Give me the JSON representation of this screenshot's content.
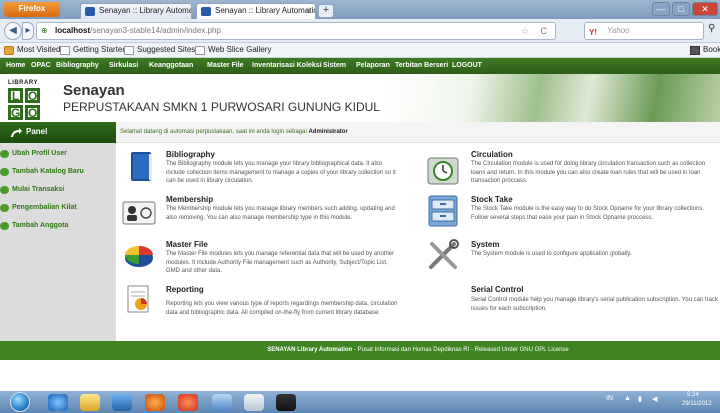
{
  "browser": {
    "menu_button": "Firefox",
    "tabs": [
      {
        "title": "Senayan :: Library Automation System"
      },
      {
        "title": "Senayan :: Library Automation System"
      }
    ],
    "new_tab": "+",
    "url_host": "localhost",
    "url_path": "/senayan3-stable14/admin/index.php",
    "search_placeholder": "Yahoo",
    "search_engine_icon": "Y!",
    "bookmarks": [
      "Most Visited",
      "Getting Started",
      "Suggested Sites",
      "Web Slice Gallery"
    ],
    "bookmarks_menu": "Bookm",
    "window_controls": [
      "—",
      "□",
      "✕"
    ]
  },
  "app_menu": [
    "Home",
    "OPAC",
    "Bibliography",
    "Sirkulasi",
    "Keanggotaan",
    "Master File",
    "Inventarisasi Koleksi",
    "Sistem",
    "Pelaporan",
    "Terbitan Berseri",
    "LOGOUT"
  ],
  "header": {
    "logo_top": "LIBRARY",
    "logo_letters": [
      "L",
      "O",
      "G",
      "O"
    ],
    "app_name": "Senayan",
    "subtitle": "PERPUSTAKAAN SMKN 1 PURWOSARI GUNUNG KIDUL"
  },
  "panel": {
    "title": "Panel",
    "items": [
      "Ubah Profil User",
      "Tambah Katalog Baru",
      "Mulai Transaksi",
      "Pengembalian Kilat",
      "Tambah Anggota"
    ]
  },
  "welcome": {
    "text": "Selamat datang di automasi perpustakaan, saat ini anda login sebagai ",
    "role": "Administrator"
  },
  "modules": [
    {
      "title": "Bibliography",
      "icon": "book-icon",
      "desc": "The Bibliography module lets you manage your library bibliographical data. It also include collection items management to manage a copies of your library collection so it can be used in library circulation."
    },
    {
      "title": "Circulation",
      "icon": "clock-icon",
      "desc": "The Circulation module is used for doing library circulation transaction such as collection loans and return. In this module you can also create loan rules that will be used in loan transaction proccess."
    },
    {
      "title": "Membership",
      "icon": "member-card-icon",
      "desc": "The Membership module lets you manage library members such adding, updating and also removing. You can also manage membership type in this module."
    },
    {
      "title": "Stock Take",
      "icon": "cabinet-icon",
      "desc": "The Stock Take module is the easy way to do Stock Opname for your library collections. Follow several steps that ease your pain in Stock Opname proccess."
    },
    {
      "title": "Master File",
      "icon": "pie-chart-icon",
      "desc": "The Master File modules lets you manage referential data that will be used by another modules. It include Authority File management such as Authority, Subject/Topic List, GMD and other data."
    },
    {
      "title": "System",
      "icon": "tools-icon",
      "desc": "The System module is used to configure application globally."
    },
    {
      "title": "Reporting",
      "icon": "report-icon",
      "desc": "Reporting lets you view various type of reports regardings membership data, circulation data and bibliographic data. All compiled on-the-fly from current library database."
    },
    {
      "title": "Serial Control",
      "icon": "serial-icon",
      "desc": "Serial Control module help you manage library's serial publication subscription. You can track issues for each subscription."
    }
  ],
  "footer": {
    "brand": "SENAYAN Library Automation",
    "text": " - Pusat Informasi dan Humas Depdiknas RI - Released Under GNU GPL License"
  },
  "taskbar": {
    "lang": "IN",
    "time": "5:24",
    "date": "29/11/2012"
  },
  "colors": {
    "menu_green": "#2d5d17",
    "link_green": "#2e7a14",
    "footer_green": "#3e8423"
  }
}
